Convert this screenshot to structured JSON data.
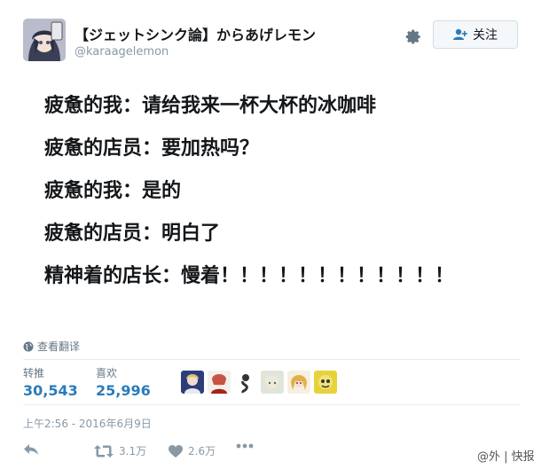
{
  "user": {
    "display_name": "【ジェットシンク論】からあげレモン",
    "handle": "@karaagelemon"
  },
  "follow_button": {
    "label": "关注",
    "icon": "add-user-icon"
  },
  "tweet_lines": [
    "疲惫的我：请给我来一杯大杯的冰咖啡",
    "疲惫的店员：要加热吗？",
    "疲惫的我：是的",
    "疲惫的店员：明白了",
    "精神着的店长：慢着！！！！！！！！！！！！"
  ],
  "translate_label": "查看翻译",
  "stats": {
    "retweets_label": "转推",
    "retweets_value": "30,543",
    "likes_label": "喜欢",
    "likes_value": "25,996"
  },
  "timestamp": "上午2:56 - 2016年6月9日",
  "actions": {
    "retweet_count": "3.1万",
    "like_count": "2.6万"
  },
  "watermark": "@外 | 快报",
  "colors": {
    "link_blue": "#2b7bb9",
    "muted": "#8899a6",
    "divider": "#e6ecf0"
  }
}
